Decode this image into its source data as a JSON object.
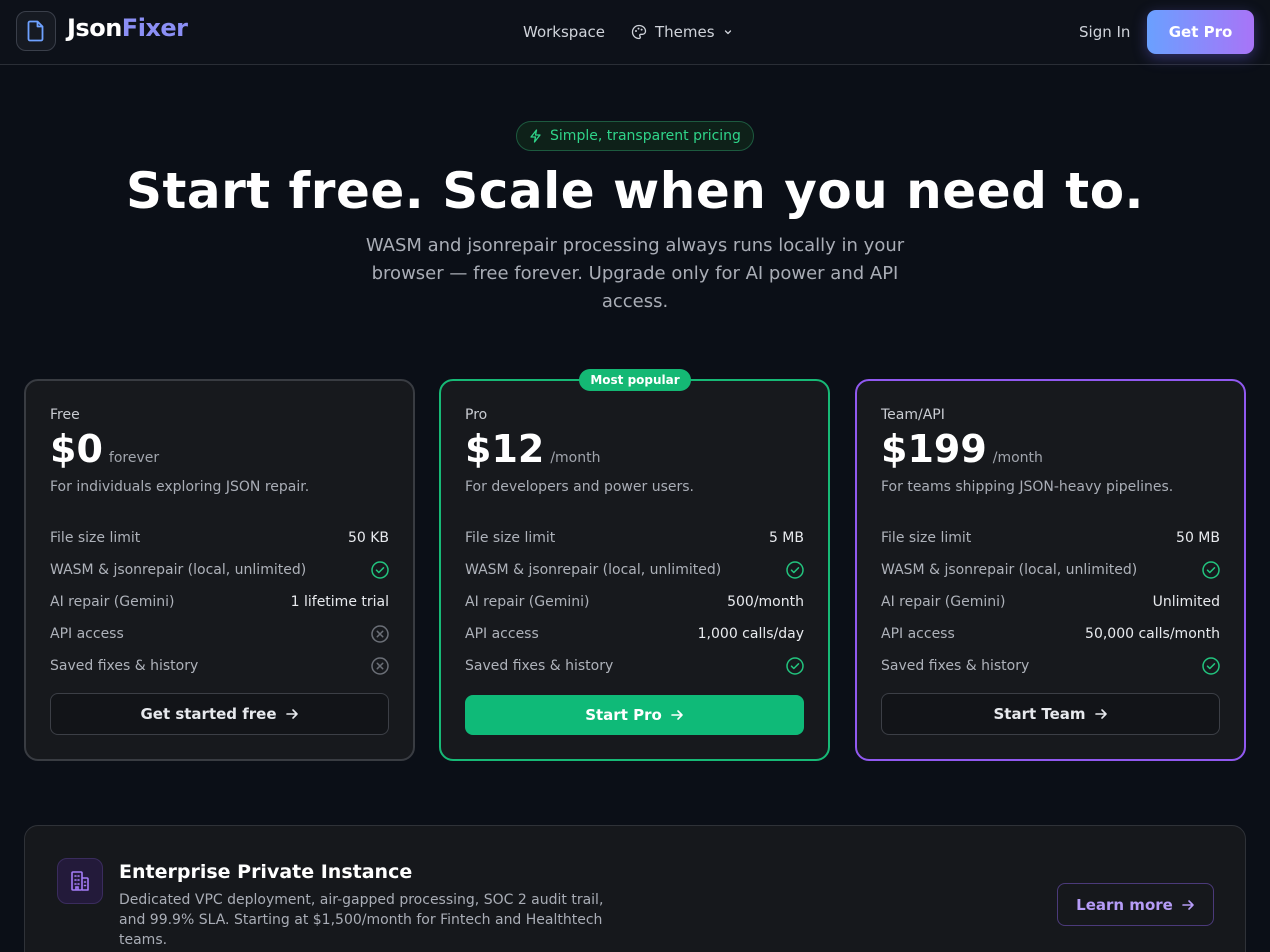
{
  "brand": {
    "name_part1": "Json",
    "name_part2": "Fixer"
  },
  "nav": {
    "workspace": "Workspace",
    "themes": "Themes",
    "sign_in": "Sign In",
    "get_pro": "Get Pro"
  },
  "hero": {
    "badge": "Simple, transparent pricing",
    "title": "Start free. Scale when you need to.",
    "subtitle": "WASM and jsonrepair processing always runs locally in your browser — free forever. Upgrade only for AI power and API access."
  },
  "plans": [
    {
      "name": "Free",
      "price": "$0",
      "period": "forever",
      "description": "For individuals exploring JSON repair.",
      "features": [
        {
          "label": "File size limit",
          "value": "50 KB"
        },
        {
          "label": "WASM & jsonrepair (local, unlimited)",
          "value": "check"
        },
        {
          "label": "AI repair (Gemini)",
          "value": "1 lifetime trial"
        },
        {
          "label": "API access",
          "value": "cross"
        },
        {
          "label": "Saved fixes & history",
          "value": "cross"
        }
      ],
      "cta": "Get started free"
    },
    {
      "name": "Pro",
      "badge": "Most popular",
      "price": "$12",
      "period": "/month",
      "description": "For developers and power users.",
      "features": [
        {
          "label": "File size limit",
          "value": "5 MB"
        },
        {
          "label": "WASM & jsonrepair (local, unlimited)",
          "value": "check"
        },
        {
          "label": "AI repair (Gemini)",
          "value": "500/month"
        },
        {
          "label": "API access",
          "value": "1,000 calls/day"
        },
        {
          "label": "Saved fixes & history",
          "value": "check"
        }
      ],
      "cta": "Start Pro"
    },
    {
      "name": "Team/API",
      "price": "$199",
      "period": "/month",
      "description": "For teams shipping JSON-heavy pipelines.",
      "features": [
        {
          "label": "File size limit",
          "value": "50 MB"
        },
        {
          "label": "WASM & jsonrepair (local, unlimited)",
          "value": "check"
        },
        {
          "label": "AI repair (Gemini)",
          "value": "Unlimited"
        },
        {
          "label": "API access",
          "value": "50,000 calls/month"
        },
        {
          "label": "Saved fixes & history",
          "value": "check"
        }
      ],
      "cta": "Start Team"
    }
  ],
  "enterprise": {
    "title": "Enterprise Private Instance",
    "description": "Dedicated VPC deployment, air-gapped processing, SOC 2 audit trail, and 99.9% SLA. Starting at $1,500/month for Fintech and Healthtech teams.",
    "cta": "Learn more"
  },
  "colors": {
    "background": "#0b0f17",
    "accent_green": "#14b874",
    "accent_purple": "#9159f0",
    "brand_gradient_start": "#6aa0ff",
    "brand_gradient_end": "#a874f7"
  },
  "icons": {
    "logo": "file-icon",
    "themes": "palette-icon",
    "badge": "lightning-icon",
    "included": "check-circle-icon",
    "excluded": "x-circle-icon",
    "cta": "arrow-right-icon",
    "enterprise": "building-icon"
  }
}
